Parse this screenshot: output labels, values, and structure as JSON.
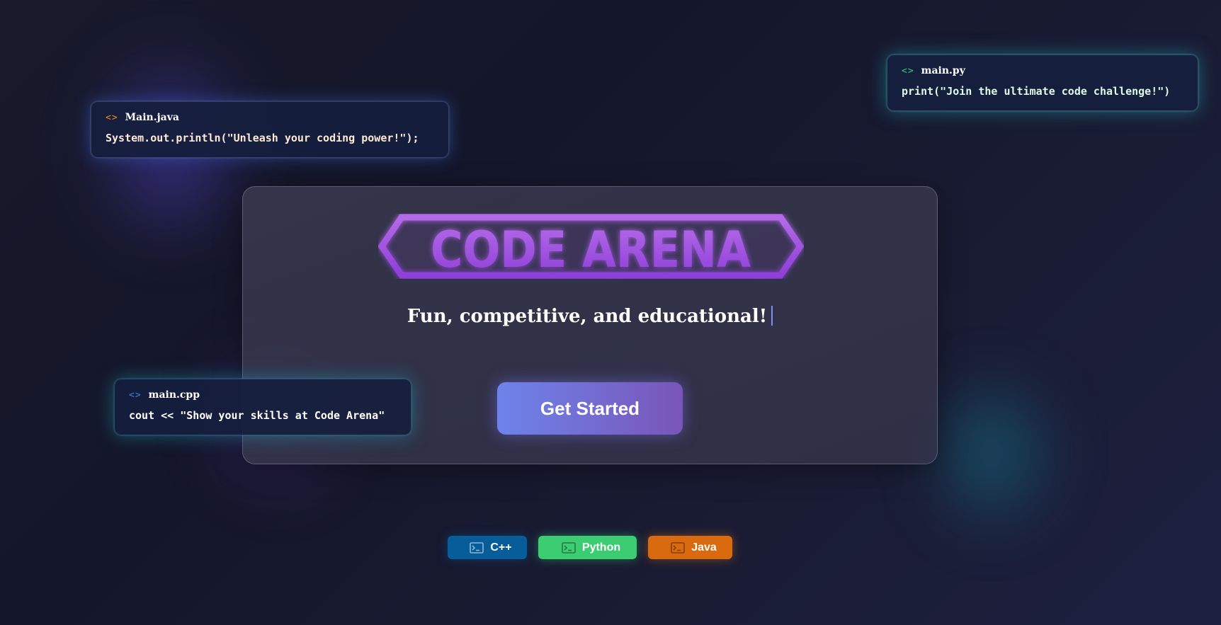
{
  "cards": {
    "java": {
      "icon": "code-brackets-icon",
      "glyph": "<>",
      "filename": "Main.java",
      "code": "System.out.println(\"Unleash your coding power!\");"
    },
    "python": {
      "icon": "code-brackets-icon",
      "glyph": "<>",
      "filename": "main.py",
      "code": "print(\"Join the ultimate code challenge!\")"
    },
    "cpp": {
      "icon": "code-brackets-icon",
      "glyph": "<>",
      "filename": "main.cpp",
      "code": "cout << \"Show your skills at Code Arena\""
    }
  },
  "hero": {
    "logo_text": "CODE ARENA",
    "subtitle": "Fun, competitive, and educational!",
    "cta_label": "Get Started"
  },
  "languages": [
    {
      "label": "C++",
      "icon": "terminal-icon"
    },
    {
      "label": "Python",
      "icon": "terminal-icon"
    },
    {
      "label": "Java",
      "icon": "terminal-icon"
    }
  ],
  "colors": {
    "logo_purple": "#9b4fe0",
    "cpp_button": "#075c9a",
    "python_button": "#3ccc72",
    "java_button": "#d96a10",
    "cta_start": "#6d84ea",
    "cta_end": "#7a55b8"
  }
}
